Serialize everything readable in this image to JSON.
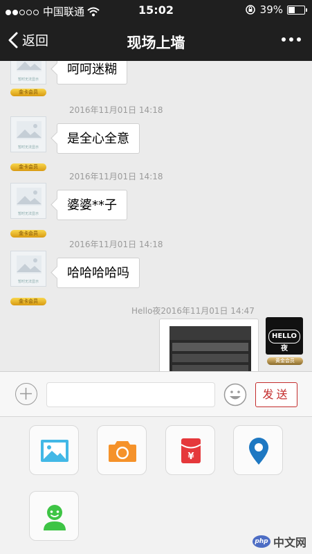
{
  "status_bar": {
    "carrier": "中国联通",
    "time": "15:02",
    "battery": "39%",
    "battery_level": 0.39
  },
  "nav": {
    "back_label": "返回",
    "title": "现场上墙"
  },
  "avatar_caption": "暂时无法显示",
  "badge_text": "金卡会员",
  "badge_text_dark": "黄金会员",
  "messages": [
    {
      "text": "呵呵迷糊"
    },
    {
      "timestamp": "2016年11月01日 14:18",
      "text": "是全心全意"
    },
    {
      "timestamp": "2016年11月01日 14:18",
      "text": "婆婆**子"
    },
    {
      "timestamp": "2016年11月01日 14:18",
      "text": "哈哈哈哈吗"
    }
  ],
  "sent": {
    "header": "Hello夜2016年11月01日 14:47",
    "avatar_label": "HELLO夜"
  },
  "input": {
    "value": "",
    "send_label": "发送"
  },
  "tools": [
    {
      "icon": "image-icon",
      "color": "#42b8e6"
    },
    {
      "icon": "camera-icon",
      "color": "#f5922a"
    },
    {
      "icon": "red-envelope-icon",
      "color": "#e5383b"
    },
    {
      "icon": "location-pin-icon",
      "color": "#1e78c2"
    },
    {
      "icon": "contact-icon",
      "color": "#3ec445"
    }
  ],
  "watermark": {
    "logo": "php",
    "text": "中文网"
  }
}
